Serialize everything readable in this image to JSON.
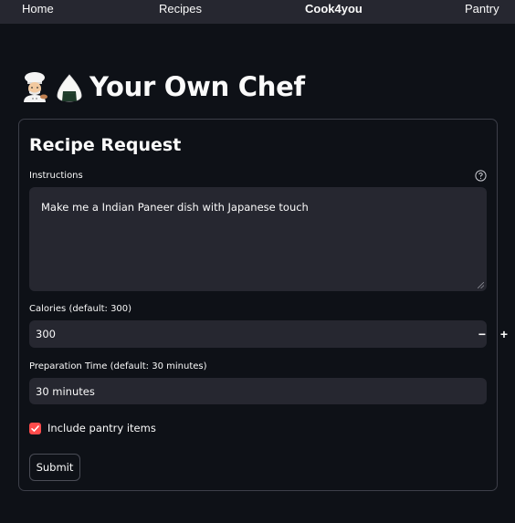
{
  "nav": {
    "items": [
      "Home",
      "Recipes",
      "Cook4you",
      "Pantry"
    ],
    "active": "Cook4you"
  },
  "page": {
    "title": "Your Own Chef",
    "title_icons": [
      "chef-emoji-icon",
      "rice-ball-emoji-icon"
    ]
  },
  "form": {
    "heading": "Recipe Request",
    "instructions": {
      "label": "Instructions",
      "value": "Make me a Indian Paneer dish with Japanese touch",
      "help_icon": "question-circle-icon"
    },
    "calories": {
      "label": "Calories (default: 300)",
      "value": "300",
      "decrement": "−",
      "increment": "+"
    },
    "prep_time": {
      "label": "Preparation Time (default: 30 minutes)",
      "value": "30 minutes"
    },
    "pantry": {
      "label": "Include pantry items",
      "checked": true
    },
    "submit_label": "Submit"
  },
  "colors": {
    "background": "#0e1117",
    "nav_bg": "#262730",
    "input_bg": "#262730",
    "accent": "#ff4b4b",
    "text": "#fafafa"
  }
}
